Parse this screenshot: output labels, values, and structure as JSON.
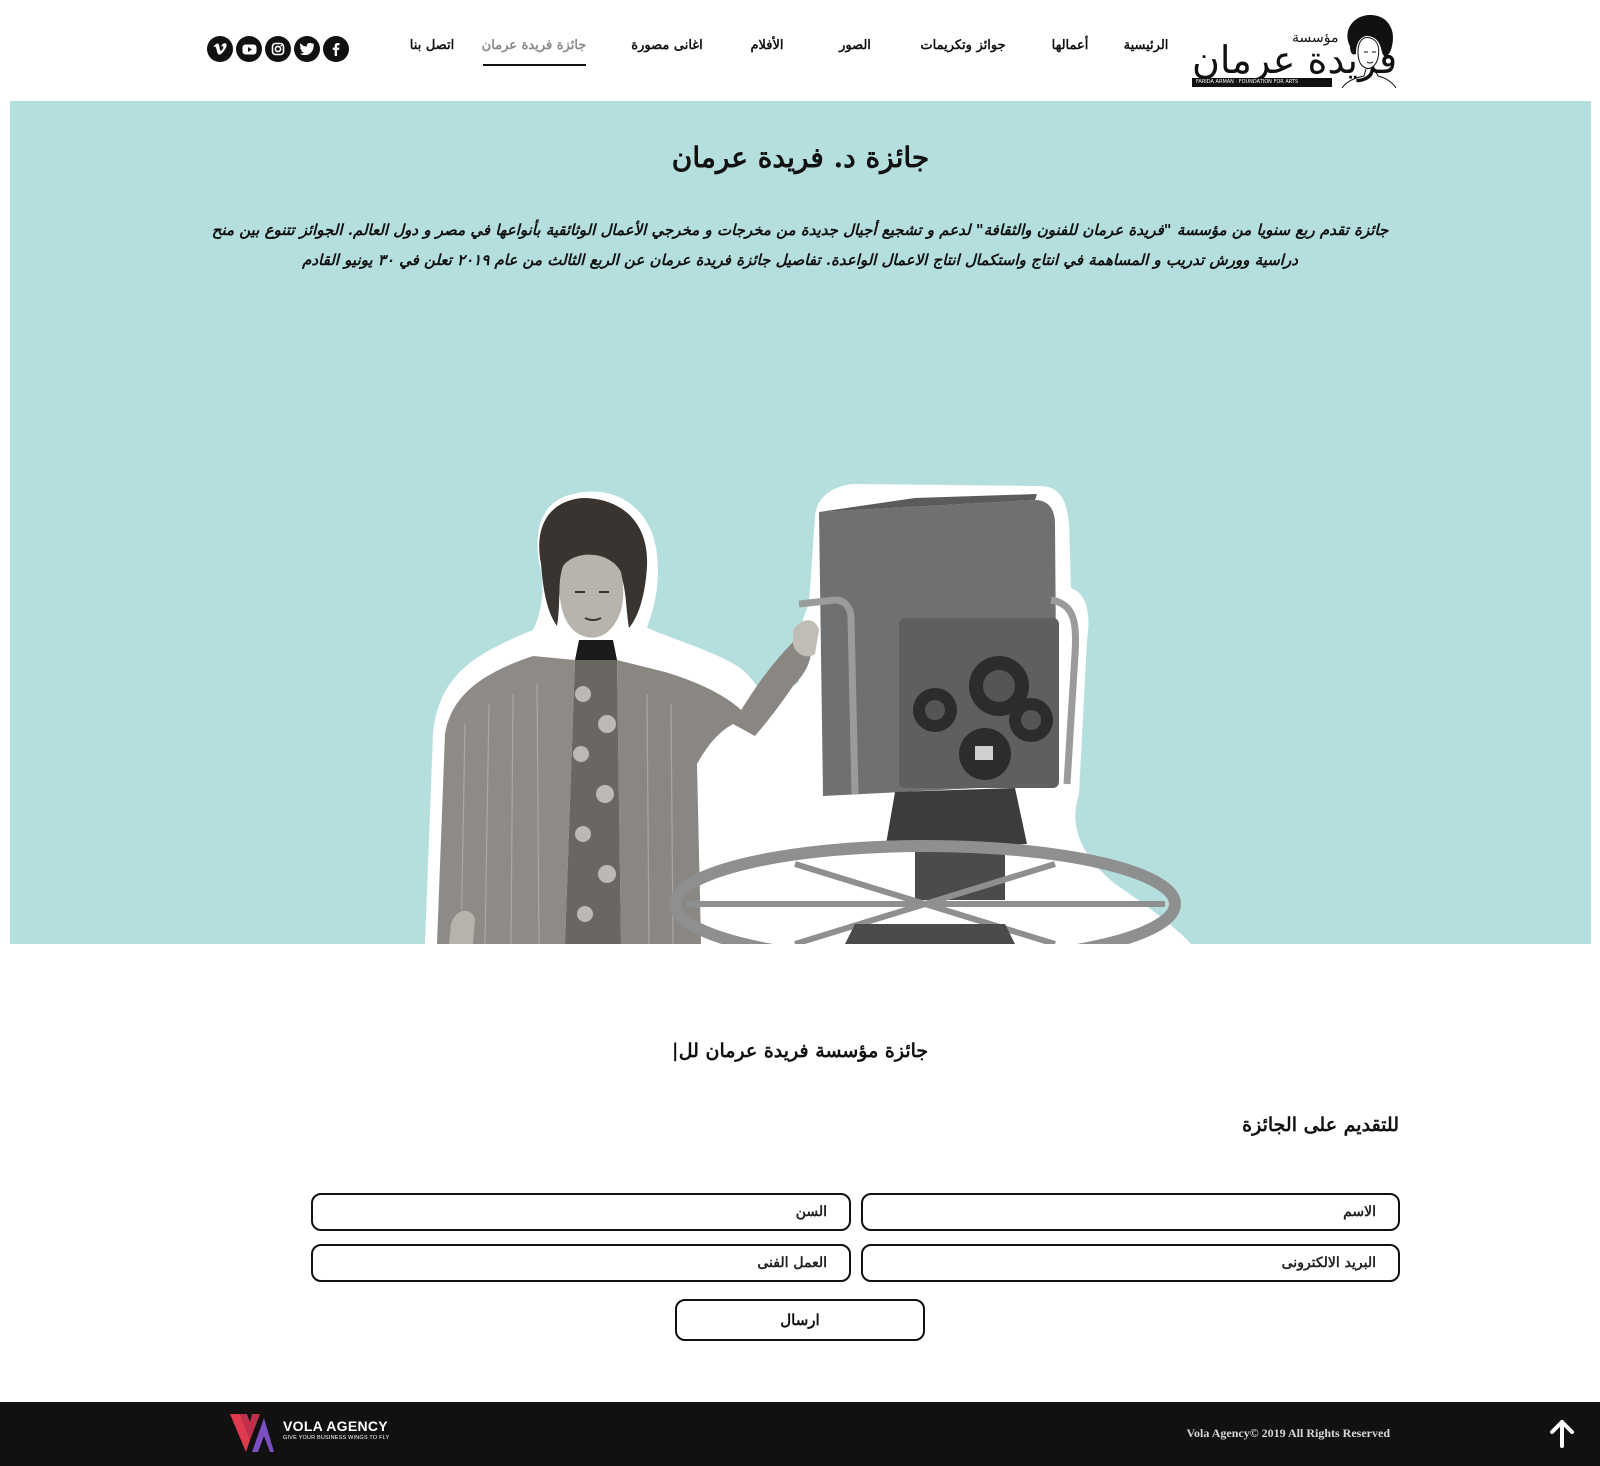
{
  "header": {
    "logo": {
      "small_text": "مؤسسة",
      "main_text": "فريدة عرمان",
      "band_text": "FARIDA ARMAN · FOUNDATION FOR ARTS"
    },
    "nav": [
      {
        "label": "الرئيسية",
        "active": false
      },
      {
        "label": "أعمالها",
        "active": false
      },
      {
        "label": "جوائز وتكريمات",
        "active": false
      },
      {
        "label": "الصور",
        "active": false
      },
      {
        "label": "الأفلام",
        "active": false
      },
      {
        "label": "اغانى مصورة",
        "active": false
      },
      {
        "label": "جائزة فريدة عرمان",
        "active": true
      },
      {
        "label": "اتصل بنا",
        "active": false
      }
    ],
    "social": [
      {
        "name": "facebook-icon",
        "glyph": "f"
      },
      {
        "name": "twitter-icon",
        "glyph": "t"
      },
      {
        "name": "instagram-icon",
        "glyph": "i"
      },
      {
        "name": "youtube-icon",
        "glyph": "y"
      },
      {
        "name": "vimeo-icon",
        "glyph": "v"
      }
    ]
  },
  "hero": {
    "title": "جائزة د. فريدة عرمان",
    "description": "جائزة تقدم ربع سنويا من مؤسسة \"فريدة عرمان للفنون والثقافة\" لدعم و تشجيع أجيال جديدة من مخرجات و مخرجي الأعمال الوثائقية بأنواعها في مصر و دول العالم. الجوائز تتنوع بين منح دراسية وورش تدريب و المساهمة في انتاج واستكمال انتاج الاعمال الواعدة. تفاصيل جائزة فريدة عرمان عن الربع الثالث من عام ٢٠١٩ تعلن في ٣٠ يونيو القادم",
    "background_color": "#b5dfdf"
  },
  "form_section": {
    "title": "جائزة مؤسسة فريدة عرمان لل|",
    "heading": "للتقديم على الجائزة",
    "fields": {
      "name_placeholder": "الاسم",
      "age_placeholder": "السن",
      "email_placeholder": "البريد الالكترونى",
      "work_placeholder": "العمل الفنى"
    },
    "submit_label": "ارسال"
  },
  "footer": {
    "agency_name": "VOLA AGENCY",
    "agency_tagline": "GIVE YOUR BUSINESS WINGS TO FLY",
    "copyright": "Vola Agency© 2019 All Rights Reserved",
    "colors": {
      "background": "#111111",
      "logo_red": "#e03a4f",
      "logo_purple": "#7b4fc2"
    }
  }
}
